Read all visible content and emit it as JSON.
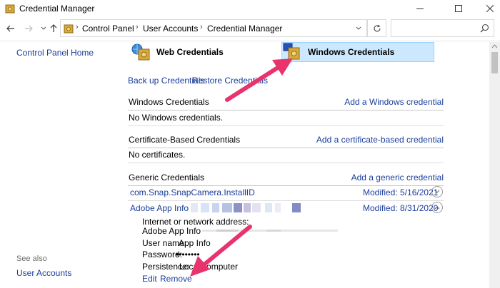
{
  "window": {
    "title": "Credential Manager",
    "controls": {
      "minimize_icon": "minimize-icon",
      "maximize_icon": "maximize-icon",
      "close_icon": "close-icon"
    }
  },
  "address_bar": {
    "crumbs": [
      "Control Panel",
      "User Accounts",
      "Credential Manager"
    ],
    "search_placeholder": ""
  },
  "left_pane": {
    "home_link": "Control Panel Home",
    "see_also_label": "See also",
    "see_also_links": [
      "User Accounts"
    ]
  },
  "vaults": {
    "web": "Web Credentials",
    "windows": "Windows Credentials",
    "selected": "Windows Credentials"
  },
  "actions": {
    "backup": "Back up Credentials",
    "restore": "Restore Credentials"
  },
  "sections": {
    "windows": {
      "title": "Windows Credentials",
      "add": "Add a Windows credential",
      "empty": "No Windows credentials."
    },
    "certificate": {
      "title": "Certificate-Based Credentials",
      "add": "Add a certificate-based credential",
      "empty": "No certificates."
    },
    "generic": {
      "title": "Generic Credentials",
      "add": "Add a generic credential"
    }
  },
  "generic_credentials": [
    {
      "name": "com.Snap.SnapCamera.InstallID",
      "modified": "Modified:  5/16/2021",
      "expanded": false
    },
    {
      "name": "Adobe App Info",
      "modified": "Modified:  8/31/2020",
      "expanded": true
    }
  ],
  "details": {
    "address_label": "Internet or network address:",
    "address_value": "Adobe App Info",
    "username_label": "User name:",
    "username_value": "App Info",
    "password_label": "Password:",
    "password_value": "••••••••",
    "persistence_label": "Persistence:",
    "persistence_value": "Local computer",
    "edit": "Edit",
    "remove": "Remove"
  },
  "colors": {
    "link": "#1a3e9c",
    "selected_bg": "#cce8ff",
    "annotation": "#e8336d"
  }
}
